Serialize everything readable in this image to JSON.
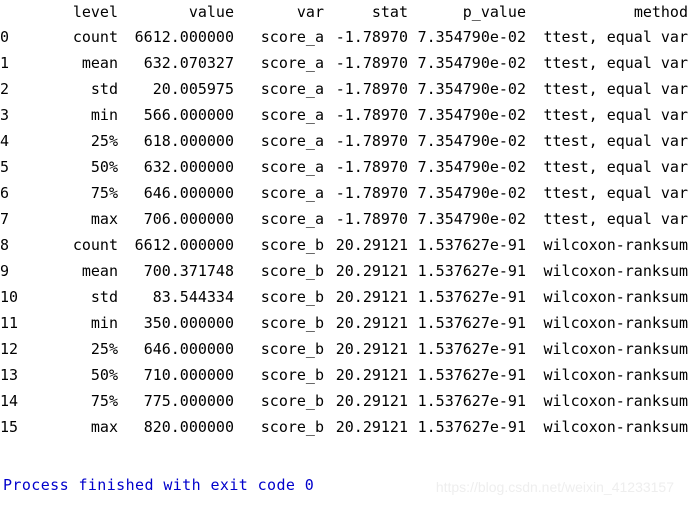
{
  "console": {
    "background_color": "#ffffff",
    "text_color": "#000000",
    "process_line": {
      "text": "Process finished with exit code 0",
      "color": "#0000cc"
    },
    "watermark": {
      "text": "https://blog.csdn.net/weixin_41233157",
      "color": "#eeeeee"
    }
  },
  "dataframe": {
    "index_header": "",
    "columns": [
      "level",
      "value",
      "var",
      "stat",
      "p_value",
      "method"
    ],
    "rows": [
      {
        "index": "0",
        "level": "count",
        "value": "6612.000000",
        "var": "score_a",
        "stat": "-1.78970",
        "p_value": "7.354790e-02",
        "method": "ttest, equal var"
      },
      {
        "index": "1",
        "level": "mean",
        "value": "632.070327",
        "var": "score_a",
        "stat": "-1.78970",
        "p_value": "7.354790e-02",
        "method": "ttest, equal var"
      },
      {
        "index": "2",
        "level": "std",
        "value": "20.005975",
        "var": "score_a",
        "stat": "-1.78970",
        "p_value": "7.354790e-02",
        "method": "ttest, equal var"
      },
      {
        "index": "3",
        "level": "min",
        "value": "566.000000",
        "var": "score_a",
        "stat": "-1.78970",
        "p_value": "7.354790e-02",
        "method": "ttest, equal var"
      },
      {
        "index": "4",
        "level": "25%",
        "value": "618.000000",
        "var": "score_a",
        "stat": "-1.78970",
        "p_value": "7.354790e-02",
        "method": "ttest, equal var"
      },
      {
        "index": "5",
        "level": "50%",
        "value": "632.000000",
        "var": "score_a",
        "stat": "-1.78970",
        "p_value": "7.354790e-02",
        "method": "ttest, equal var"
      },
      {
        "index": "6",
        "level": "75%",
        "value": "646.000000",
        "var": "score_a",
        "stat": "-1.78970",
        "p_value": "7.354790e-02",
        "method": "ttest, equal var"
      },
      {
        "index": "7",
        "level": "max",
        "value": "706.000000",
        "var": "score_a",
        "stat": "-1.78970",
        "p_value": "7.354790e-02",
        "method": "ttest, equal var"
      },
      {
        "index": "8",
        "level": "count",
        "value": "6612.000000",
        "var": "score_b",
        "stat": "20.29121",
        "p_value": "1.537627e-91",
        "method": "wilcoxon-ranksum"
      },
      {
        "index": "9",
        "level": "mean",
        "value": "700.371748",
        "var": "score_b",
        "stat": "20.29121",
        "p_value": "1.537627e-91",
        "method": "wilcoxon-ranksum"
      },
      {
        "index": "10",
        "level": "std",
        "value": "83.544334",
        "var": "score_b",
        "stat": "20.29121",
        "p_value": "1.537627e-91",
        "method": "wilcoxon-ranksum"
      },
      {
        "index": "11",
        "level": "min",
        "value": "350.000000",
        "var": "score_b",
        "stat": "20.29121",
        "p_value": "1.537627e-91",
        "method": "wilcoxon-ranksum"
      },
      {
        "index": "12",
        "level": "25%",
        "value": "646.000000",
        "var": "score_b",
        "stat": "20.29121",
        "p_value": "1.537627e-91",
        "method": "wilcoxon-ranksum"
      },
      {
        "index": "13",
        "level": "50%",
        "value": "710.000000",
        "var": "score_b",
        "stat": "20.29121",
        "p_value": "1.537627e-91",
        "method": "wilcoxon-ranksum"
      },
      {
        "index": "14",
        "level": "75%",
        "value": "775.000000",
        "var": "score_b",
        "stat": "20.29121",
        "p_value": "1.537627e-91",
        "method": "wilcoxon-ranksum"
      },
      {
        "index": "15",
        "level": "max",
        "value": "820.000000",
        "var": "score_b",
        "stat": "20.29121",
        "p_value": "1.537627e-91",
        "method": "wilcoxon-ranksum"
      }
    ]
  }
}
